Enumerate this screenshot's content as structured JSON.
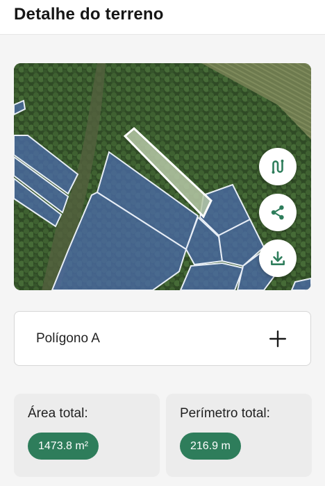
{
  "header": {
    "title": "Detalhe do terreno"
  },
  "map": {
    "actions": [
      {
        "name": "route-icon",
        "label": "route"
      },
      {
        "name": "share-icon",
        "label": "share"
      },
      {
        "name": "download-icon",
        "label": "download"
      }
    ]
  },
  "polygon": {
    "label": "Polígono A",
    "add_icon": "plus-icon"
  },
  "stats": {
    "area": {
      "title": "Área total:",
      "value": "1473.8 m²"
    },
    "perimeter": {
      "title": "Perímetro total:",
      "value": "216.9 m"
    }
  },
  "colors": {
    "accent": "#2e7d5b",
    "polygon_fill": "#4a6aa8",
    "selected_polygon_fill": "#b5c7a6",
    "card_bg": "#ececec"
  }
}
